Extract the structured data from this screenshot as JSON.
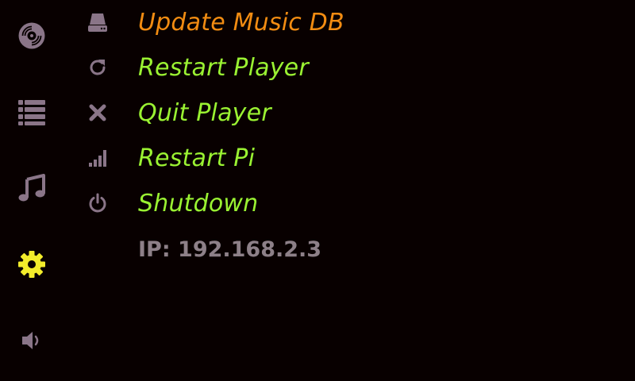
{
  "colors": {
    "background": "#080000",
    "icon_muted": "#8a7588",
    "active_settings": "#f2ec2b",
    "label_highlight": "#f28c12",
    "label_normal": "#9af232",
    "ip_text": "#8d8088"
  },
  "sidebar": {
    "items": [
      {
        "icon": "disc-icon",
        "active": false
      },
      {
        "icon": "list-icon",
        "active": false
      },
      {
        "icon": "music-note-icon",
        "active": false
      },
      {
        "icon": "gear-icon",
        "active": true
      },
      {
        "icon": "speaker-icon",
        "active": false
      }
    ]
  },
  "menu": {
    "items": [
      {
        "label": "Update Music DB",
        "icon": "drive-icon",
        "highlighted": true
      },
      {
        "label": "Restart Player",
        "icon": "refresh-icon",
        "highlighted": false
      },
      {
        "label": "Quit Player",
        "icon": "close-icon",
        "highlighted": false
      },
      {
        "label": "Restart Pi",
        "icon": "signal-bars-icon",
        "highlighted": false
      },
      {
        "label": "Shutdown",
        "icon": "power-icon",
        "highlighted": false
      }
    ]
  },
  "status": {
    "ip": "IP: 192.168.2.3"
  }
}
